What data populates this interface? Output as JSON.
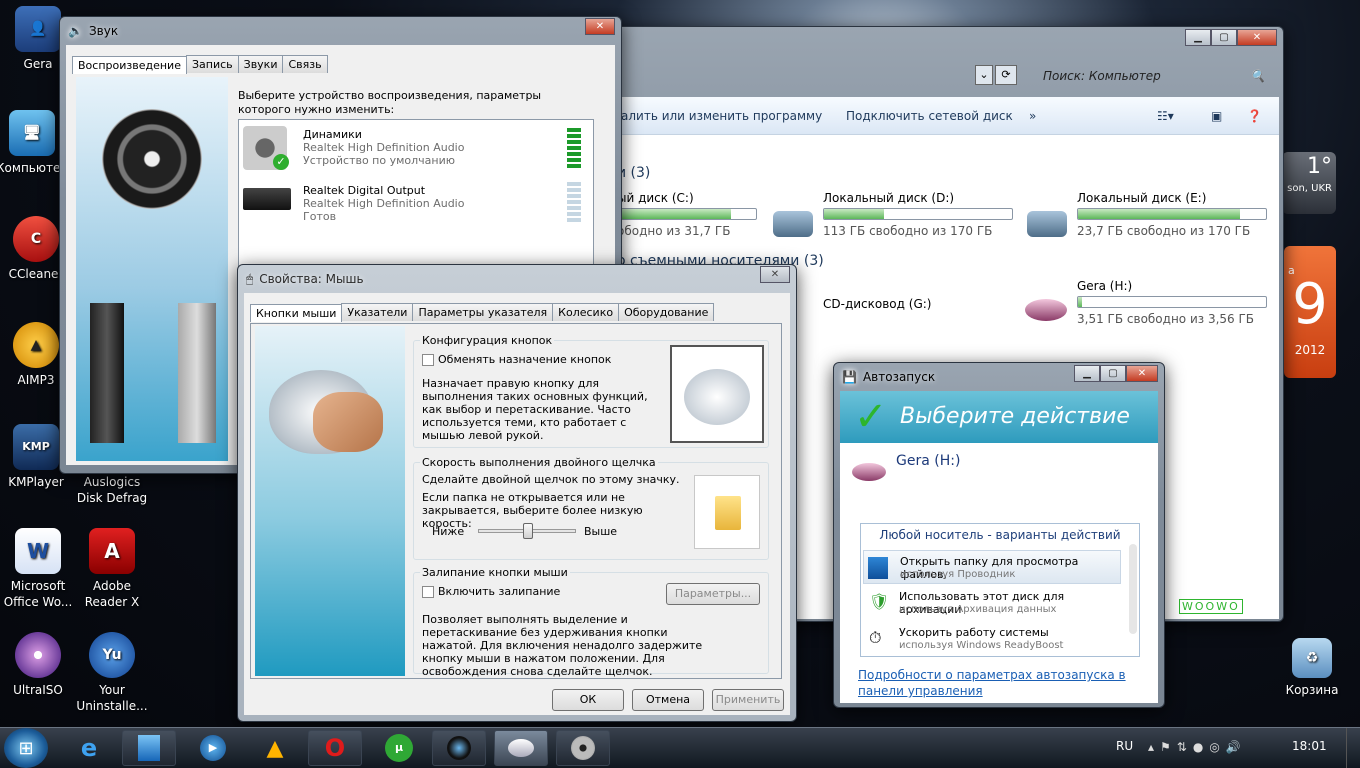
{
  "desktop": {
    "icons": [
      "Gera",
      "Компьютер",
      "CCleaner",
      "AIMP3",
      "KMPlayer",
      "Auslogics Disk Defrag",
      "Microsoft Office Wo...",
      "Adobe Reader X",
      "UltraISO",
      "Your Uninstalle...",
      "Корзина"
    ],
    "weather_temp": "1°",
    "weather_loc": "son, UKR",
    "calendar_day": "9",
    "calendar_year": "2012",
    "calendar_month_frag": "а",
    "woowo": "WOOWO"
  },
  "explorer": {
    "search_placeholder": "Поиск: Компьютер",
    "toolbar": {
      "uninstall": "алить или изменить программу",
      "map_drive": "Подключить сетевой диск",
      "more": "»"
    },
    "hdd_header": "и (3)",
    "removable_header": "о съемными носителями (3)",
    "drives": [
      {
        "name": "ый диск (C:)",
        "free": "ободно из 31,7 ГБ",
        "used": 0.82
      },
      {
        "name": "Локальный диск (D:)",
        "free": "113 ГБ свободно из 170 ГБ",
        "used": 0.32
      },
      {
        "name": "Локальный диск (E:)",
        "free": "23,7 ГБ свободно из 170 ГБ",
        "used": 0.86
      }
    ],
    "cd": "CD-дисковод (G:)",
    "gera": {
      "name": "Gera (H:)",
      "free": "3,51 ГБ свободно из 3,56 ГБ",
      "used": 0.02
    }
  },
  "sound": {
    "title": "Звук",
    "tabs": [
      "Воспроизведение",
      "Запись",
      "Звуки",
      "Связь"
    ],
    "prompt": "Выберите устройство воспроизведения, параметры которого нужно изменить:",
    "devices": [
      {
        "name": "Динамики",
        "driver": "Realtek High Definition Audio",
        "status": "Устройство по умолчанию"
      },
      {
        "name": "Realtek Digital Output",
        "driver": "Realtek High Definition Audio",
        "status": "Готов"
      }
    ]
  },
  "mouse": {
    "title": "Свойства: Мышь",
    "tabs": [
      "Кнопки мыши",
      "Указатели",
      "Параметры указателя",
      "Колесико",
      "Оборудование"
    ],
    "config_group": "Конфигурация кнопок",
    "swap_label": "Обменять назначение кнопок",
    "swap_desc": "Назначает правую кнопку для выполнения таких основных функций, как выбор и перетаскивание. Часто используется теми, кто работает с мышью левой рукой.",
    "speed_group": "Скорость выполнения двойного щелчка",
    "speed_desc1": "Сделайте двойной щелчок по этому значку.",
    "speed_desc2": "Если папка не открывается или не закрывается, выберите более низкую корость:",
    "slow": "Ниже",
    "fast": "Выше",
    "speed_level": 0.5,
    "lock_group": "Залипание кнопки мыши",
    "lock_label": "Включить залипание",
    "params_btn": "Параметры...",
    "lock_desc": "Позволяет выполнять выделение и перетаскивание без удерживания кнопки нажатой. Для включения ненадолго задержите кнопку мыши в нажатом положении. Для освобождения снова сделайте щелчок.",
    "ok": "ОК",
    "cancel": "Отмена",
    "apply": "Применить"
  },
  "autoplay": {
    "title": "Автозапуск",
    "header": "Выберите действие",
    "drive": "Gera (H:)",
    "section": "Любой носитель - варианты действий",
    "options": [
      {
        "label": "Открыть папку для просмотра файлов,",
        "sub": "используя Проводник"
      },
      {
        "label": "Использовать этот диск для архивации",
        "sub": "используя Архивация данных"
      },
      {
        "label": "Ускорить работу системы",
        "sub": "используя Windows ReadyBoost"
      }
    ],
    "link": "Подробности о параметрах автозапуска в панели управления"
  },
  "taskbar": {
    "lang": "RU",
    "time": "18:01"
  }
}
